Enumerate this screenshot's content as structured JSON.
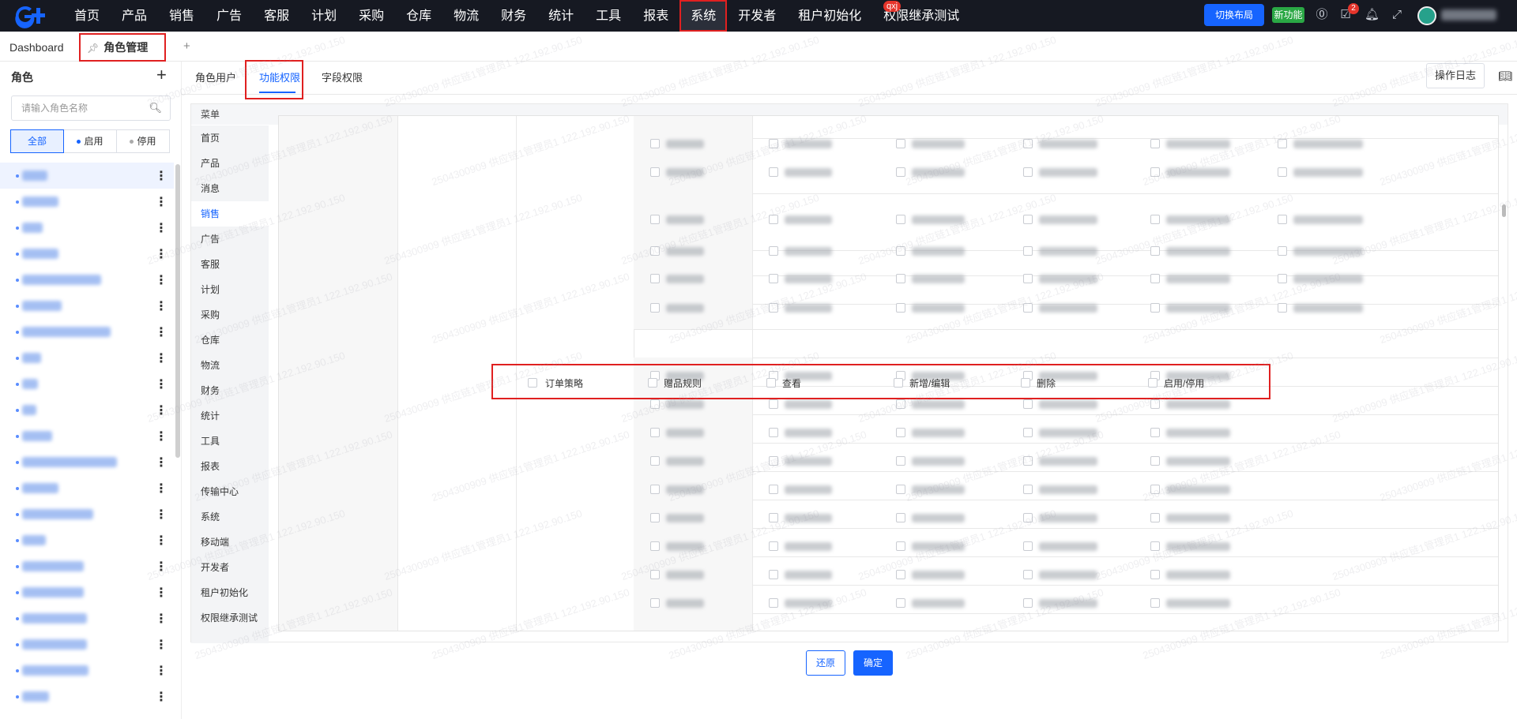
{
  "nav": {
    "items": [
      "首页",
      "产品",
      "销售",
      "广告",
      "客服",
      "计划",
      "采购",
      "仓库",
      "物流",
      "财务",
      "统计",
      "工具",
      "报表",
      "系统",
      "开发者",
      "租户初始化",
      "权限继承测试"
    ],
    "active": "系统",
    "badge": "qxj",
    "switch_layout": "切换布局",
    "new_feature": "新功能",
    "notif_count": "2"
  },
  "tabs": {
    "dashboard": "Dashboard",
    "role_manage": "角色管理",
    "add": "+"
  },
  "left": {
    "title": "角色",
    "add": "+",
    "search_placeholder": "请输入角色名称",
    "filters": [
      "全部",
      "启用",
      "停用"
    ],
    "role_count": 21
  },
  "subtabs": {
    "role_users": "角色用户",
    "func_perm": "功能权限",
    "field_perm": "字段权限",
    "op_log": "操作日志"
  },
  "panel": {
    "head": "菜单",
    "menu": [
      "首页",
      "产品",
      "消息",
      "销售",
      "广告",
      "客服",
      "计划",
      "采购",
      "仓库",
      "物流",
      "财务",
      "统计",
      "工具",
      "报表",
      "传输中心",
      "系统",
      "移动端",
      "开发者",
      "租户初始化",
      "权限继承测试"
    ],
    "menu_selected": "销售"
  },
  "highlight_row": {
    "group": "订单策略",
    "name": "赠品规则",
    "perms": [
      "查看",
      "新增/编辑",
      "删除",
      "启用/停用"
    ]
  },
  "actions": {
    "reset": "还原",
    "confirm": "确定"
  },
  "colors": {
    "accent": "#1664ff",
    "nav_bg": "#161922",
    "highlight": "#e02020",
    "green": "#2aa845"
  }
}
